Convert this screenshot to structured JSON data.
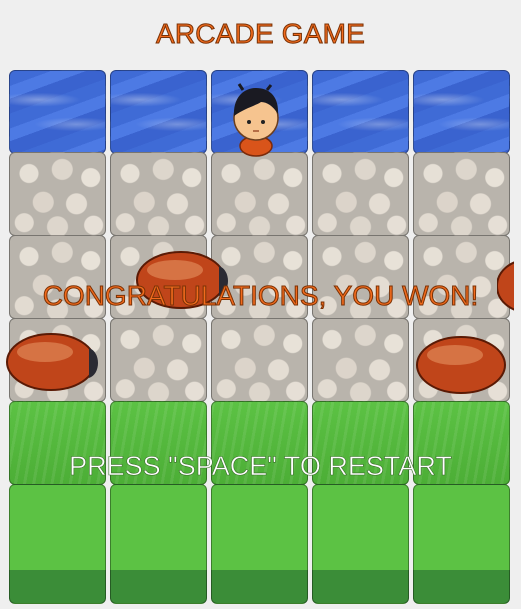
{
  "game": {
    "title": "ARCADE GAME",
    "win_message": "CONGRATULATIONS, YOU WON!",
    "restart_prompt": "PRESS \"SPACE\" TO RESTART",
    "state": "won"
  },
  "board": {
    "columns": 5,
    "rows": [
      {
        "type": "water"
      },
      {
        "type": "stone"
      },
      {
        "type": "stone"
      },
      {
        "type": "stone"
      },
      {
        "type": "grass"
      },
      {
        "type": "grass"
      }
    ]
  },
  "sprites": {
    "player": {
      "name": "boy-player",
      "row": 0,
      "col": 2
    },
    "enemies": [
      {
        "name": "ladybug",
        "row": 2
      },
      {
        "name": "ladybug",
        "row": 3
      },
      {
        "name": "ladybug",
        "row": 3
      },
      {
        "name": "ladybug",
        "row": 2
      }
    ]
  },
  "colors": {
    "title_fill": "#f26b1d",
    "title_stroke": "#7a3206",
    "restart_text": "#ffffff",
    "background": "#efefef"
  }
}
